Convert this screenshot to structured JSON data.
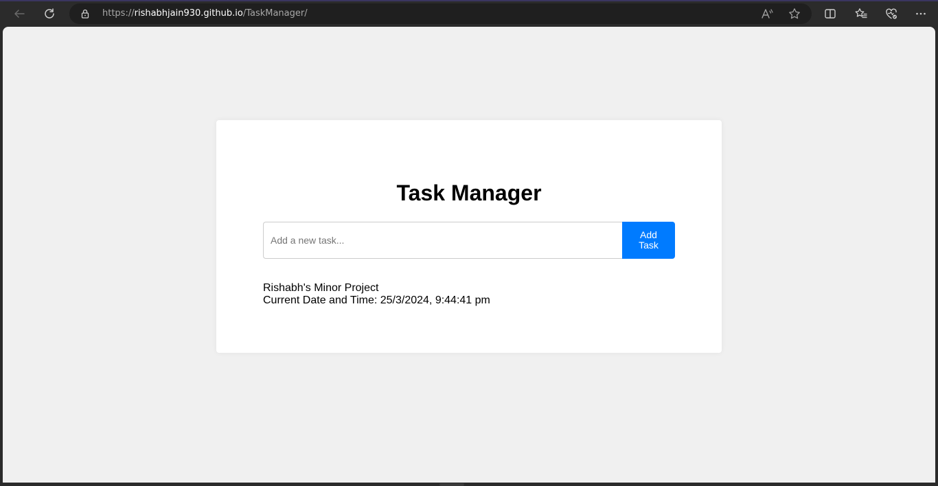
{
  "browser": {
    "url_scheme": "https://",
    "url_host": "rishabhjain930.github.io",
    "url_path": "/TaskManager/",
    "icons": [
      "back-arrow-icon",
      "refresh-icon",
      "lock-icon",
      "read-aloud-icon",
      "favorite-star-icon",
      "split-screen-icon",
      "favorites-icon",
      "browser-essentials-icon",
      "more-options-icon"
    ]
  },
  "page": {
    "title": "Task Manager",
    "input_placeholder": "Add a new task...",
    "input_value": "",
    "add_button_label": "Add Task",
    "project_label": "Rishabh's Minor Project",
    "datetime_label": "Current Date and Time: 25/3/2024, 9:44:41 pm"
  },
  "colors": {
    "accent": "#007bff",
    "page_background": "#f0f0f0",
    "card_background": "#ffffff",
    "browser_chrome": "#2b2b2b"
  }
}
